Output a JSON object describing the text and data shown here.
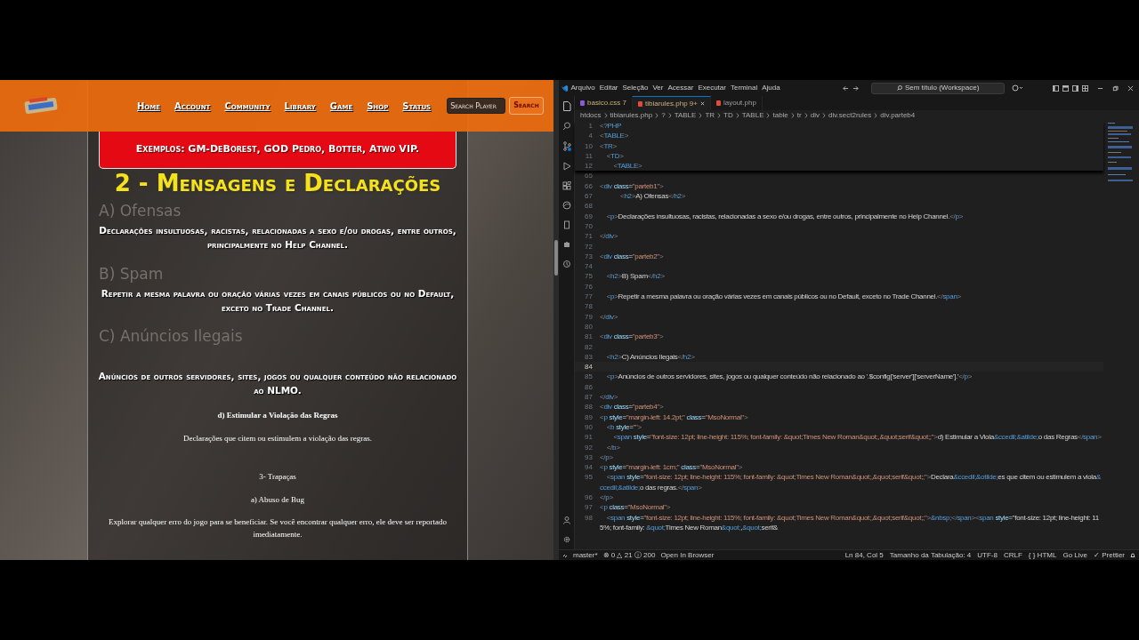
{
  "site": {
    "nav": [
      {
        "label": "Home"
      },
      {
        "label": "Account"
      },
      {
        "label": "Community"
      },
      {
        "label": "Library"
      },
      {
        "label": "Game"
      },
      {
        "label": "Shop"
      },
      {
        "label": "Status"
      }
    ],
    "search": {
      "placeholder": "Search Player",
      "button": "Search"
    },
    "notice": "Exemplos: GM-DeBorest, GOD Pedro, Botter, Atwo VIP.",
    "title": "2 - Mensagens e Declarações",
    "sections": [
      {
        "kind": "styled",
        "heading": "A) Ofensas",
        "text": "Declarações insultuosas, racistas, relacionadas a sexo e/ou drogas, entre outros, principalmente no Help Channel."
      },
      {
        "kind": "styled",
        "heading": "B) Spam",
        "text": "Repetir a mesma palavra ou oração várias vezes em canais públicos ou no Default, exceto no Trade Channel."
      },
      {
        "kind": "styled",
        "heading": "C) Anúncios Ilegais",
        "text": "Anúncios de outros servidores, sites, jogos ou qualquer conteúdo não relacionado ao NLMO."
      },
      {
        "kind": "plain",
        "heading": "d) Estimular a Violação das Regras",
        "text": "Declarações que citem ou estimulem a violação das regras."
      }
    ],
    "part3": {
      "title": "3- Trapaças",
      "heading": "a) Abuso de Bug",
      "text": "Explorar qualquer erro do jogo para se beneficiar. Se você encontrar qualquer erro, ele deve ser reportado imediatamente."
    }
  },
  "editor": {
    "menu": [
      "Arquivo",
      "Editar",
      "Seleção",
      "Ver",
      "Acessar",
      "Executar",
      "Terminal",
      "Ajuda"
    ],
    "command_center": "Sem título (Workspace)",
    "tabs": [
      {
        "label": "basico.css",
        "badge": "7",
        "kind": "css",
        "selected": false
      },
      {
        "label": "tibiarules.php",
        "badge": "9+",
        "kind": "php",
        "selected": true
      },
      {
        "label": "layout.php",
        "kind": "php",
        "selected": false
      }
    ],
    "breadcrumb": [
      "htdocs",
      "tibiarules.php",
      "?",
      "TABLE",
      "TR",
      "TD",
      "TABLE",
      "table",
      "tr",
      "div",
      "div.sect2rules",
      "div.parteb4"
    ],
    "sticky_lines": [
      {
        "n": "1",
        "code": "<?PHP"
      },
      {
        "n": "4",
        "code": "<TABLE>"
      },
      {
        "n": "10",
        "code": "<TR>"
      },
      {
        "n": "11",
        "code": "    <TD>"
      },
      {
        "n": "12",
        "code": "        <TABLE>"
      }
    ],
    "lines": [
      {
        "n": "65",
        "current": false
      },
      {
        "n": "66",
        "code": "<div class=\"parteb1\">",
        "current": false
      },
      {
        "n": "67",
        "code": "            <h2>A) Ofensas</h2>",
        "current": false
      },
      {
        "n": "68",
        "current": false
      },
      {
        "n": "69",
        "code": "    <p>Declarações insultuosas, racistas, relacionadas a sexo e/ou drogas, entre outros, principalmente no Help Channel.</p>",
        "current": false
      },
      {
        "n": "70",
        "current": false
      },
      {
        "n": "71",
        "code": "</div>",
        "current": false
      },
      {
        "n": "72",
        "current": false
      },
      {
        "n": "73",
        "code": "<div class=\"parteb2\">",
        "current": false
      },
      {
        "n": "74",
        "current": false
      },
      {
        "n": "75",
        "code": "    <h2>B) Spam</h2>",
        "current": false
      },
      {
        "n": "76",
        "current": false
      },
      {
        "n": "77",
        "code": "    <p>Repetir a mesma palavra ou oração várias vezes em canais públicos ou no Default, exceto no Trade Channel.</span>",
        "current": false
      },
      {
        "n": "78",
        "current": false
      },
      {
        "n": "79",
        "code": "</div>",
        "current": false
      },
      {
        "n": "80",
        "current": false
      },
      {
        "n": "81",
        "code": "<div class=\"parteb3\">",
        "current": false
      },
      {
        "n": "82",
        "current": false
      },
      {
        "n": "83",
        "code": "    <h2>C) Anúncios Ilegais</h2>",
        "current": false
      },
      {
        "n": "84",
        "current": true
      },
      {
        "n": "85",
        "code": "    <p>Anúncios de outros servidores, sites, jogos ou qualquer conteúdo não relacionado ao '.$config['server']['serverName'].'</p>",
        "current": false
      },
      {
        "n": "86",
        "current": false
      },
      {
        "n": "87",
        "code": "</div>",
        "current": false
      },
      {
        "n": "88",
        "code": "<div class=\"parteb4\">",
        "current": false
      },
      {
        "n": "89",
        "code": "<p style=\"margin-left: 14.2pt;\" class=\"MsoNormal\">",
        "current": false
      },
      {
        "n": "90",
        "code": "    <b style=\"\">",
        "current": false
      },
      {
        "n": "91",
        "code": "        <span style=\"font-size: 12pt; line-height: 115%; font-family: &quot;Times New Roman&quot;,&quot;serif&quot;;\">d) Estimular a Viola&ccedil;&atilde;o das Regras</span>",
        "current": false
      },
      {
        "n": "92",
        "code": "    </b>",
        "current": false
      },
      {
        "n": "93",
        "code": "</p>",
        "current": false
      },
      {
        "n": "94",
        "code": "<p style=\"margin-left: 1cm;\" class=\"MsoNormal\">",
        "current": false
      },
      {
        "n": "95",
        "code": "    <span style=\"font-size: 12pt; line-height: 115%; font-family: &quot;Times New Roman&quot;,&quot;serif&quot;;\">Declara&ccedil;&otilde;es que citem ou estimulem a viola&ccedil;&atilde;o das regras.</span>",
        "current": false
      },
      {
        "n": "96",
        "code": "</p>",
        "current": false
      },
      {
        "n": "97",
        "code": "<p class=\"MsoNormal\">",
        "current": false
      },
      {
        "n": "98",
        "code": "    <span style=\"font-size: 12pt; line-height: 115%; font-family: &quot;Times New Roman&quot;,&quot;serif&quot;;\">&nbsp;</span><span style=\"font-size: 12pt; line-height: 115%; font-family: &quot;Times New Roman&quot;,&quot;serif&",
        "current": false
      }
    ],
    "status_left": [
      "master*",
      "⊗ 0 △ 21 ⓘ 200",
      "Open In Browser"
    ],
    "status_right": [
      "Ln 84, Col 5",
      "Tamanho da Tabulação: 4",
      "UTF-8",
      "CRLF",
      "{ } HTML",
      "Go Live",
      "✓ Prettier"
    ]
  }
}
